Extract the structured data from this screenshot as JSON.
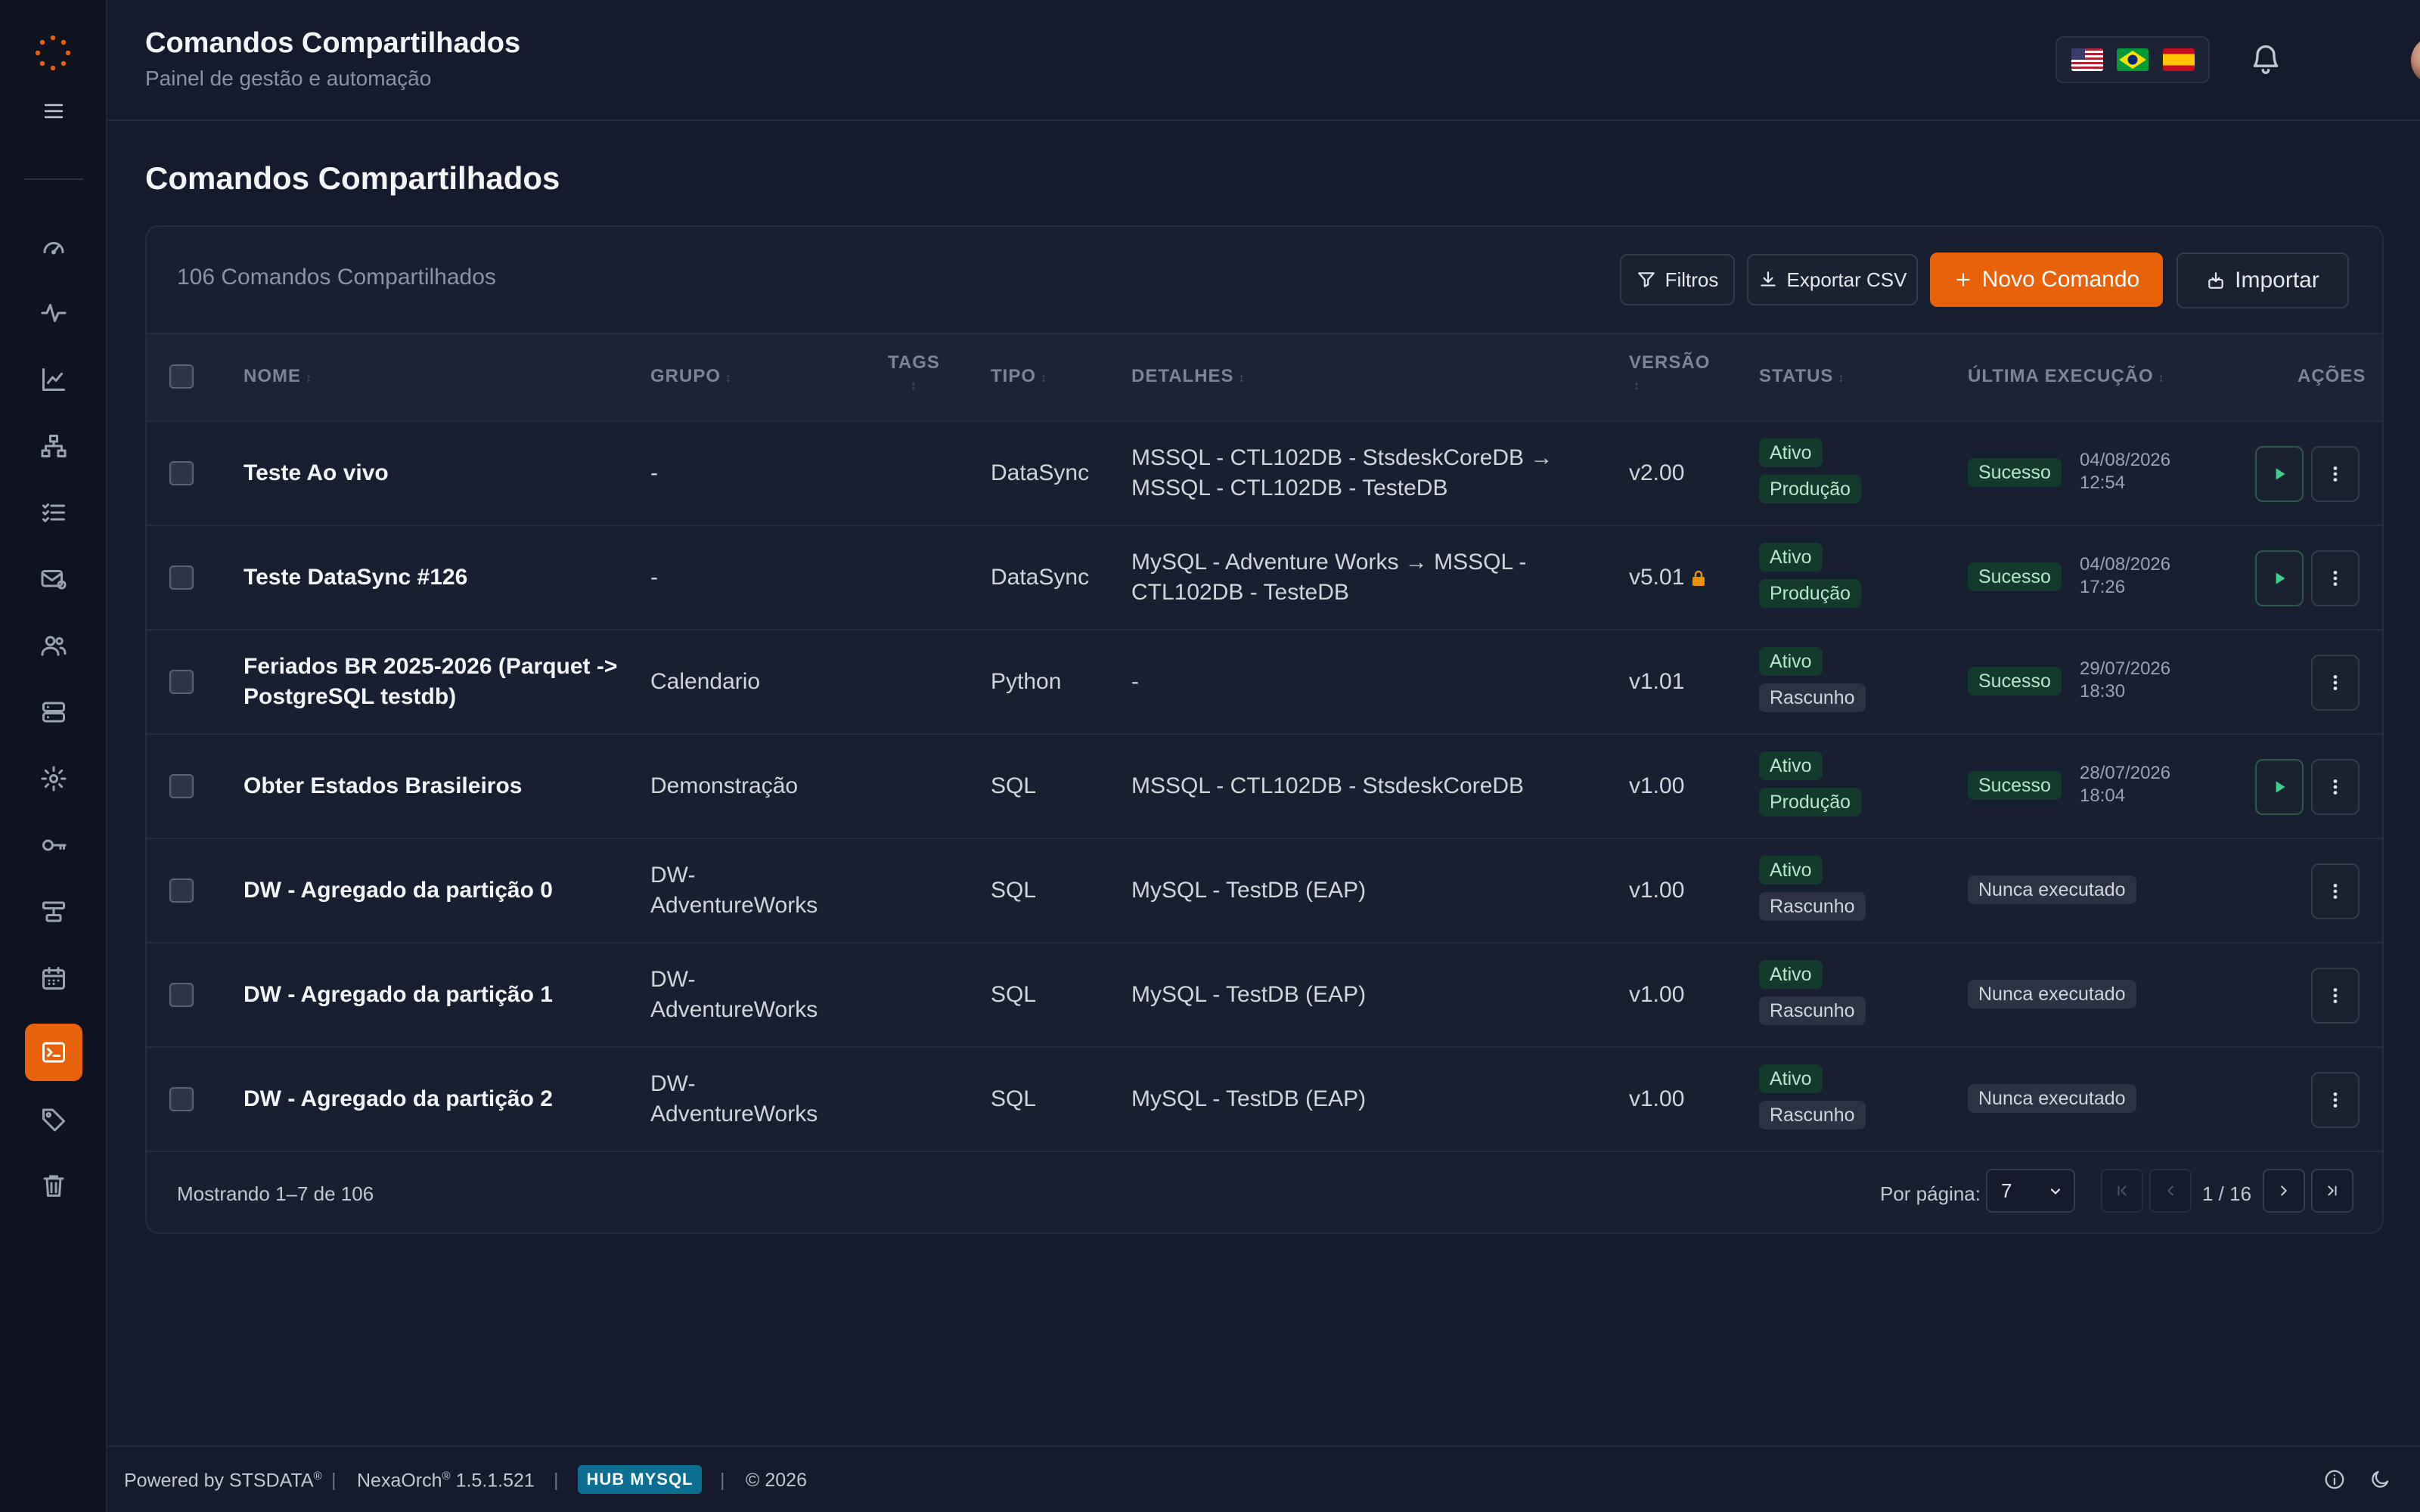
{
  "header": {
    "title": "Comandos Compartilhados",
    "subtitle": "Painel de gestão e automação"
  },
  "page": {
    "title": "Comandos Compartilhados",
    "count_label": "106 Comandos Compartilhados"
  },
  "toolbar": {
    "filters_label": "Filtros",
    "export_label": "Exportar CSV",
    "new_label": "Novo Comando",
    "import_label": "Importar"
  },
  "columns": {
    "name": "NOME",
    "group": "GRUPO",
    "tags": "TAGS",
    "type": "TIPO",
    "details": "DETALHES",
    "version": "VERSÃO",
    "status": "STATUS",
    "last_exec": "ÚLTIMA EXECUÇÃO",
    "actions": "AÇÕES"
  },
  "rows": [
    {
      "name_l1": "Teste Ao vivo",
      "name_l2": "",
      "group_l1": "-",
      "group_l2": "",
      "type": "DataSync",
      "details_l1": "MSSQL - CTL102DB - StsdeskCoreDB →",
      "details_l2": "MSSQL - CTL102DB - TesteDB",
      "version": "v2.00",
      "status1": "Ativo",
      "status2": "Produção",
      "exec_status": "Sucesso",
      "exec_date": "04/08/2026",
      "exec_time": "12:54"
    },
    {
      "name_l1": "Teste DataSync #126",
      "name_l2": "",
      "group_l1": "-",
      "group_l2": "",
      "type": "DataSync",
      "details_l1": "MySQL - Adventure Works → MSSQL -",
      "details_l2": "CTL102DB - TesteDB",
      "version": "v5.01",
      "status1": "Ativo",
      "status2": "Produção",
      "exec_status": "Sucesso",
      "exec_date": "04/08/2026",
      "exec_time": "17:26"
    },
    {
      "name_l1": "Feriados BR 2025-2026 (Parquet ->",
      "name_l2": "PostgreSQL testdb)",
      "group_l1": "Calendario",
      "group_l2": "",
      "type": "Python",
      "details_l1": "-",
      "details_l2": "",
      "version": "v1.01",
      "status1": "Ativo",
      "status2": "Rascunho",
      "exec_status": "Sucesso",
      "exec_date": "29/07/2026",
      "exec_time": "18:30"
    },
    {
      "name_l1": "Obter Estados Brasileiros",
      "name_l2": "",
      "group_l1": "Demonstração",
      "group_l2": "",
      "type": "SQL",
      "details_l1": "MSSQL - CTL102DB - StsdeskCoreDB",
      "details_l2": "",
      "version": "v1.00",
      "status1": "Ativo",
      "status2": "Produção",
      "exec_status": "Sucesso",
      "exec_date": "28/07/2026",
      "exec_time": "18:04"
    },
    {
      "name_l1": "DW - Agregado da partição 0",
      "name_l2": "",
      "group_l1": "DW-",
      "group_l2": "AdventureWorks",
      "type": "SQL",
      "details_l1": "MySQL - TestDB (EAP)",
      "details_l2": "",
      "version": "v1.00",
      "status1": "Ativo",
      "status2": "Rascunho",
      "exec_status": "Nunca executado",
      "exec_date": "",
      "exec_time": ""
    },
    {
      "name_l1": "DW - Agregado da partição 1",
      "name_l2": "",
      "group_l1": "DW-",
      "group_l2": "AdventureWorks",
      "type": "SQL",
      "details_l1": "MySQL - TestDB (EAP)",
      "details_l2": "",
      "version": "v1.00",
      "status1": "Ativo",
      "status2": "Rascunho",
      "exec_status": "Nunca executado",
      "exec_date": "",
      "exec_time": ""
    },
    {
      "name_l1": "DW - Agregado da partição 2",
      "name_l2": "",
      "group_l1": "DW-",
      "group_l2": "AdventureWorks",
      "type": "SQL",
      "details_l1": "MySQL - TestDB (EAP)",
      "details_l2": "",
      "version": "v1.00",
      "status1": "Ativo",
      "status2": "Rascunho",
      "exec_status": "Nunca executado",
      "exec_date": "",
      "exec_time": ""
    }
  ],
  "pagination": {
    "showing": "Mostrando 1–7 de 106",
    "per_page_label": "Por página:",
    "per_page_value": "7",
    "page_text": "1 / 16"
  },
  "footer": {
    "powered": "Powered by STSDATA",
    "reg": "®",
    "product": "NexaOrch",
    "product_reg": "®",
    "version": "1.5.1.521",
    "hub": "HUB MYSQL",
    "copyright": "© 2026",
    "sep": "|"
  },
  "colors": {
    "accent": "#e8620c",
    "success_bg": "#143a2e",
    "hub_bg": "#0c6e90"
  }
}
